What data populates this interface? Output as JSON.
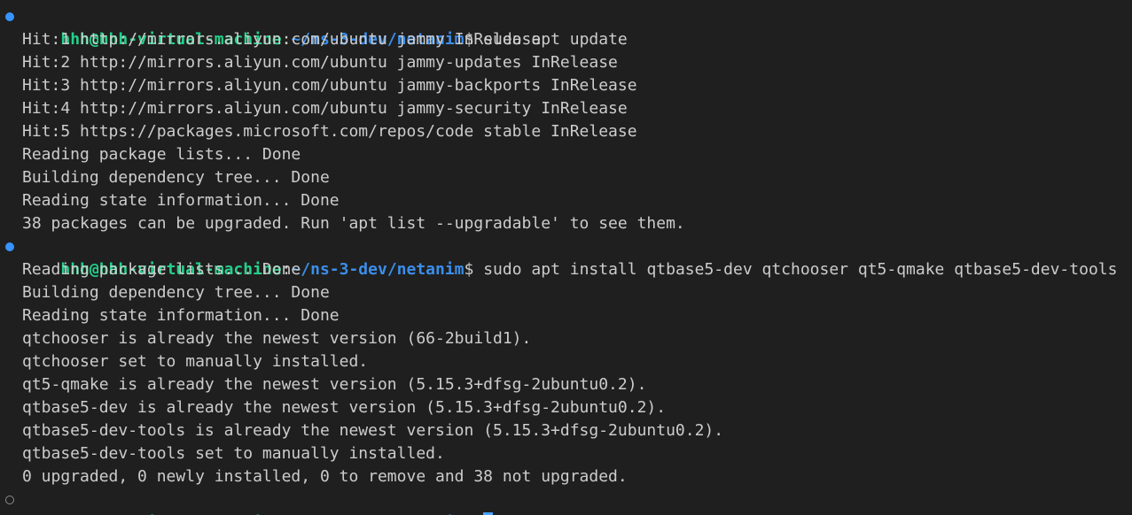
{
  "prompt": {
    "user_host": "hhh@hhh-virtual-machine",
    "colon": ":",
    "path": "~/ns-3-dev/netanim",
    "symbol": "$ "
  },
  "colors": {
    "background": "#1f1f1f",
    "text": "#cccccc",
    "user_host": "#23d18b",
    "path": "#3b8eea",
    "cursor": "#4aa3ff",
    "decoration_success": "#3794ff"
  },
  "commands": [
    {
      "command": "sudo apt update",
      "status": "success",
      "output": [
        "Hit:1 http://mirrors.aliyun.com/ubuntu jammy InRelease",
        "Hit:2 http://mirrors.aliyun.com/ubuntu jammy-updates InRelease",
        "Hit:3 http://mirrors.aliyun.com/ubuntu jammy-backports InRelease",
        "Hit:4 http://mirrors.aliyun.com/ubuntu jammy-security InRelease",
        "Hit:5 https://packages.microsoft.com/repos/code stable InRelease",
        "Reading package lists... Done",
        "Building dependency tree... Done",
        "Reading state information... Done",
        "38 packages can be upgraded. Run 'apt list --upgradable' to see them."
      ]
    },
    {
      "command": "sudo apt install qtbase5-dev qtchooser qt5-qmake qtbase5-dev-tools",
      "status": "success",
      "output": [
        "Reading package lists... Done",
        "Building dependency tree... Done",
        "Reading state information... Done",
        "qtchooser is already the newest version (66-2build1).",
        "qtchooser set to manually installed.",
        "qt5-qmake is already the newest version (5.15.3+dfsg-2ubuntu0.2).",
        "qtbase5-dev is already the newest version (5.15.3+dfsg-2ubuntu0.2).",
        "qtbase5-dev-tools is already the newest version (5.15.3+dfsg-2ubuntu0.2).",
        "qtbase5-dev-tools set to manually installed.",
        "0 upgraded, 0 newly installed, 0 to remove and 38 not upgraded."
      ]
    },
    {
      "command": "",
      "status": "pending",
      "output": []
    }
  ]
}
